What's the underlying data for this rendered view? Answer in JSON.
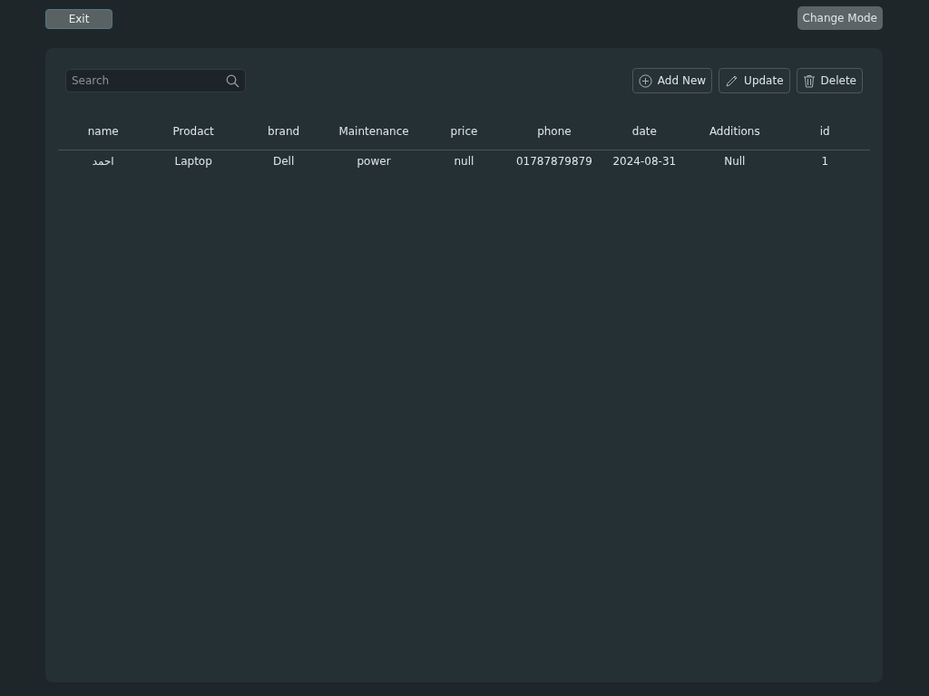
{
  "top_bar": {
    "exit_button": "Exit",
    "mode_button": "Change Mode"
  },
  "search": {
    "placeholder": "Search"
  },
  "actions": [
    {
      "kind": "add",
      "label": "Add New"
    },
    {
      "kind": "edit",
      "label": "Update"
    },
    {
      "kind": "delete",
      "label": "Delete"
    }
  ],
  "table": {
    "columns": [
      "name",
      "Prodact",
      "brand",
      "Maintenance",
      "price",
      "phone",
      "date",
      "Additions",
      "id"
    ],
    "rows": [
      [
        "احمد",
        "Laptop",
        "Dell",
        "power",
        "null",
        "01787879879",
        "2024-08-31",
        "Null",
        "1"
      ]
    ]
  }
}
